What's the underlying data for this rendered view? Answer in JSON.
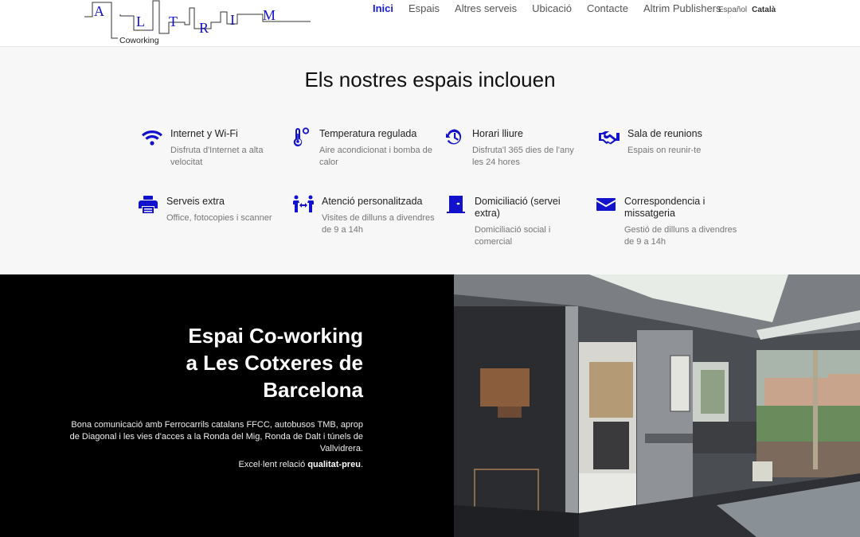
{
  "header": {
    "logo": {
      "letters": [
        "A",
        "L",
        "T",
        "R",
        "I",
        "M"
      ],
      "subtitle": "Coworking"
    },
    "nav": [
      {
        "label": "Inici",
        "active": true
      },
      {
        "label": "Espais",
        "active": false
      },
      {
        "label": "Altres serveis",
        "active": false
      },
      {
        "label": "Ubicació",
        "active": false
      },
      {
        "label": "Contacte",
        "active": false
      },
      {
        "label": "Altrim Publishers",
        "active": false
      }
    ],
    "languages": [
      {
        "label": "Español",
        "current": false
      },
      {
        "label": "Català",
        "current": true
      }
    ]
  },
  "features": {
    "title": "Els nostres espais inclouen",
    "accent_color": "#1212cc",
    "items": [
      {
        "icon": "wifi-icon",
        "title": "Internet y Wi-Fi",
        "desc": "Disfruta d'Internet a alta velocitat"
      },
      {
        "icon": "thermometer-icon",
        "title": "Temperatura regulada",
        "desc": "Aire acondicionat i bomba de calor"
      },
      {
        "icon": "history-clock-icon",
        "title": "Horari lliure",
        "desc": "Disfruta'l 365 dies de l'any les 24 hores"
      },
      {
        "icon": "handshake-icon",
        "title": "Sala de reunions",
        "desc": "Espais on reunir-te"
      },
      {
        "icon": "printer-icon",
        "title": "Serveis extra",
        "desc": "Office, fotocopies i scanner"
      },
      {
        "icon": "people-arrows-icon",
        "title": "Atenció personalitzada",
        "desc": "Visites de dilluns a divendres de 9 a 14h"
      },
      {
        "icon": "door-icon",
        "title": "Domiciliació (servei extra)",
        "desc": "Domiciliació social i comercial"
      },
      {
        "icon": "envelope-icon",
        "title": "Correspondencia i missatgeria",
        "desc": "Gestió de dilluns a divendres de 9 a 14h"
      }
    ]
  },
  "hero": {
    "title_lines": [
      "Espai Co-working",
      "a Les Cotxeres de",
      "Barcelona"
    ],
    "description": "Bona comunicació amb Ferrocarrils catalans FFCC, autobusos TMB, aprop de Diagonal i les vies d'acces a la Ronda del Mig, Ronda de Dalt i túnels de Vallvidrera.",
    "value_prefix": "Excel·lent relació ",
    "value_bold": "qualitat-preu",
    "value_suffix": ".",
    "image_alt": "Coworking lobby interior"
  }
}
